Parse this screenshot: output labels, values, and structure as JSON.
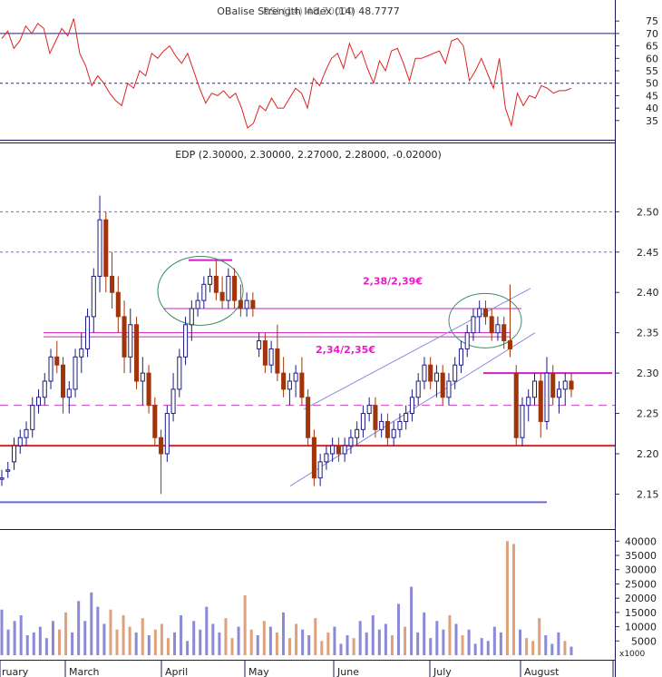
{
  "chart_data": [
    {
      "panel": "indicator",
      "type": "line",
      "title": "OBalise Strength Index (14) 48.7777",
      "title_overlap": "RSI (14) 48,70000",
      "ylim": [
        28,
        82
      ],
      "yticks": [
        35,
        40,
        45,
        50,
        55,
        60,
        65,
        70,
        75
      ],
      "reference_lines": [
        {
          "y": 70,
          "style": "solid",
          "color": "#22227a"
        },
        {
          "y": 50,
          "style": "dashed",
          "color": "#2222aa"
        }
      ],
      "series": [
        {
          "color": "#dd2222",
          "values": [
            68,
            71,
            64,
            67,
            73,
            70,
            74,
            72,
            62,
            67,
            72,
            69,
            76,
            62,
            57,
            49,
            53,
            50,
            46,
            43,
            41,
            50,
            48,
            55,
            53,
            62,
            60,
            63,
            65,
            61,
            58,
            62,
            55,
            48,
            42,
            46,
            45,
            47,
            44,
            46,
            40,
            32,
            34,
            41,
            39,
            44,
            40,
            40,
            44,
            48,
            46,
            40,
            52,
            49,
            55,
            60,
            62,
            56,
            66,
            60,
            63,
            56,
            50,
            59,
            55,
            63,
            64,
            58,
            51,
            60,
            60,
            61,
            62,
            63,
            58,
            67,
            68,
            65,
            51,
            55,
            60,
            54,
            48,
            60,
            40,
            33,
            46,
            41,
            45,
            44,
            49,
            48,
            46,
            47,
            47,
            48
          ]
        }
      ]
    },
    {
      "panel": "price",
      "type": "candlestick",
      "title": "EDP (2.30000, 2.30000, 2.27000, 2.28000, -0.02000)",
      "ylim": [
        2.11,
        2.56
      ],
      "yticks": [
        2.15,
        2.2,
        2.25,
        2.3,
        2.35,
        2.4,
        2.45,
        2.5
      ],
      "ytick_labels": [
        "2.15",
        "2.20",
        "2.25",
        "2.30",
        "2.35",
        "2.40",
        "2.45",
        "2.50"
      ],
      "annotations": [
        {
          "text": "2,38/2,39€",
          "x": "July",
          "y": 2.41,
          "color": "#e020c0"
        },
        {
          "text": "2,34/2,35€",
          "x": "May",
          "y": 2.325,
          "color": "#e020c0"
        }
      ],
      "horizontal_lines": [
        {
          "y": 2.45,
          "style": "dashed",
          "color": "#6a6ad8"
        },
        {
          "y": 2.5,
          "style": "dashed",
          "color": "#6a6ad8"
        },
        {
          "y": 2.26,
          "style": "dashed",
          "color": "#d040c0"
        },
        {
          "y": 2.21,
          "style": "solid",
          "color": "#dd2222"
        },
        {
          "y": 2.14,
          "style": "solid",
          "color": "#6a6ad8"
        }
      ],
      "ohlc": [
        [
          2.17,
          2.18,
          2.16,
          2.17
        ],
        [
          2.18,
          2.19,
          2.17,
          2.18
        ],
        [
          2.19,
          2.22,
          2.18,
          2.21
        ],
        [
          2.21,
          2.23,
          2.2,
          2.22
        ],
        [
          2.22,
          2.24,
          2.21,
          2.23
        ],
        [
          2.23,
          2.27,
          2.22,
          2.26
        ],
        [
          2.26,
          2.28,
          2.25,
          2.27
        ],
        [
          2.27,
          2.3,
          2.26,
          2.29
        ],
        [
          2.29,
          2.33,
          2.28,
          2.32
        ],
        [
          2.32,
          2.34,
          2.3,
          2.31
        ],
        [
          2.31,
          2.32,
          2.25,
          2.27
        ],
        [
          2.27,
          2.29,
          2.25,
          2.28
        ],
        [
          2.28,
          2.33,
          2.27,
          2.32
        ],
        [
          2.32,
          2.35,
          2.3,
          2.33
        ],
        [
          2.33,
          2.38,
          2.32,
          2.37
        ],
        [
          2.37,
          2.43,
          2.35,
          2.42
        ],
        [
          2.42,
          2.52,
          2.4,
          2.49
        ],
        [
          2.49,
          2.5,
          2.4,
          2.42
        ],
        [
          2.42,
          2.45,
          2.38,
          2.4
        ],
        [
          2.4,
          2.42,
          2.35,
          2.37
        ],
        [
          2.37,
          2.39,
          2.3,
          2.32
        ],
        [
          2.32,
          2.38,
          2.3,
          2.36
        ],
        [
          2.36,
          2.37,
          2.28,
          2.29
        ],
        [
          2.29,
          2.32,
          2.26,
          2.3
        ],
        [
          2.3,
          2.31,
          2.25,
          2.26
        ],
        [
          2.26,
          2.27,
          2.21,
          2.22
        ],
        [
          2.22,
          2.23,
          2.15,
          2.2
        ],
        [
          2.2,
          2.26,
          2.19,
          2.25
        ],
        [
          2.25,
          2.3,
          2.24,
          2.28
        ],
        [
          2.28,
          2.33,
          2.27,
          2.32
        ],
        [
          2.32,
          2.37,
          2.31,
          2.36
        ],
        [
          2.36,
          2.39,
          2.34,
          2.38
        ],
        [
          2.38,
          2.4,
          2.37,
          2.39
        ],
        [
          2.39,
          2.42,
          2.38,
          2.41
        ],
        [
          2.41,
          2.43,
          2.4,
          2.42
        ],
        [
          2.42,
          2.44,
          2.39,
          2.4
        ],
        [
          2.4,
          2.42,
          2.38,
          2.39
        ],
        [
          2.39,
          2.43,
          2.38,
          2.42
        ],
        [
          2.42,
          2.43,
          2.38,
          2.39
        ],
        [
          2.39,
          2.41,
          2.37,
          2.38
        ],
        [
          2.38,
          2.4,
          2.37,
          2.39
        ],
        [
          2.39,
          2.4,
          2.37,
          2.38
        ],
        [
          2.33,
          2.35,
          2.32,
          2.34
        ],
        [
          2.34,
          2.35,
          2.3,
          2.31
        ],
        [
          2.31,
          2.34,
          2.3,
          2.33
        ],
        [
          2.33,
          2.36,
          2.29,
          2.3
        ],
        [
          2.3,
          2.32,
          2.27,
          2.28
        ],
        [
          2.28,
          2.3,
          2.26,
          2.29
        ],
        [
          2.29,
          2.31,
          2.27,
          2.3
        ],
        [
          2.3,
          2.32,
          2.26,
          2.27
        ],
        [
          2.27,
          2.28,
          2.21,
          2.22
        ],
        [
          2.22,
          2.23,
          2.16,
          2.17
        ],
        [
          2.17,
          2.2,
          2.16,
          2.19
        ],
        [
          2.19,
          2.21,
          2.18,
          2.2
        ],
        [
          2.2,
          2.22,
          2.19,
          2.21
        ],
        [
          2.21,
          2.22,
          2.19,
          2.2
        ],
        [
          2.2,
          2.22,
          2.19,
          2.21
        ],
        [
          2.21,
          2.23,
          2.2,
          2.22
        ],
        [
          2.22,
          2.24,
          2.21,
          2.23
        ],
        [
          2.23,
          2.26,
          2.22,
          2.25
        ],
        [
          2.25,
          2.27,
          2.24,
          2.26
        ],
        [
          2.26,
          2.27,
          2.22,
          2.23
        ],
        [
          2.23,
          2.25,
          2.22,
          2.24
        ],
        [
          2.24,
          2.25,
          2.21,
          2.22
        ],
        [
          2.22,
          2.24,
          2.21,
          2.23
        ],
        [
          2.23,
          2.25,
          2.22,
          2.24
        ],
        [
          2.24,
          2.26,
          2.23,
          2.25
        ],
        [
          2.25,
          2.28,
          2.24,
          2.27
        ],
        [
          2.27,
          2.3,
          2.26,
          2.29
        ],
        [
          2.29,
          2.32,
          2.28,
          2.31
        ],
        [
          2.31,
          2.32,
          2.28,
          2.29
        ],
        [
          2.29,
          2.31,
          2.27,
          2.3
        ],
        [
          2.3,
          2.31,
          2.26,
          2.27
        ],
        [
          2.27,
          2.3,
          2.26,
          2.29
        ],
        [
          2.29,
          2.32,
          2.28,
          2.31
        ],
        [
          2.31,
          2.34,
          2.3,
          2.33
        ],
        [
          2.33,
          2.36,
          2.32,
          2.35
        ],
        [
          2.35,
          2.38,
          2.34,
          2.37
        ],
        [
          2.37,
          2.39,
          2.35,
          2.38
        ],
        [
          2.38,
          2.39,
          2.36,
          2.37
        ],
        [
          2.37,
          2.38,
          2.34,
          2.35
        ],
        [
          2.35,
          2.37,
          2.34,
          2.36
        ],
        [
          2.36,
          2.37,
          2.33,
          2.34
        ],
        [
          2.34,
          2.41,
          2.32,
          2.33
        ],
        [
          2.3,
          2.31,
          2.21,
          2.22
        ],
        [
          2.22,
          2.27,
          2.21,
          2.26
        ],
        [
          2.26,
          2.28,
          2.24,
          2.27
        ],
        [
          2.27,
          2.3,
          2.26,
          2.29
        ],
        [
          2.29,
          2.3,
          2.22,
          2.24
        ],
        [
          2.24,
          2.32,
          2.23,
          2.3
        ],
        [
          2.3,
          2.31,
          2.26,
          2.27
        ],
        [
          2.27,
          2.29,
          2.25,
          2.28
        ],
        [
          2.28,
          2.3,
          2.26,
          2.29
        ],
        [
          2.29,
          2.3,
          2.27,
          2.28
        ]
      ]
    },
    {
      "panel": "volume",
      "type": "bar",
      "units_label": "x1000",
      "ylim": [
        0,
        42000
      ],
      "yticks": [
        5000,
        10000,
        15000,
        20000,
        25000,
        30000,
        35000,
        40000
      ],
      "ytick_labels": [
        "5000",
        "10000",
        "15000",
        "20000",
        "25000",
        "30000",
        "35000",
        "40000"
      ],
      "values": [
        16000,
        9000,
        12000,
        14000,
        7000,
        8000,
        10000,
        6000,
        12000,
        9000,
        15000,
        8000,
        19000,
        12000,
        22000,
        17000,
        11000,
        16000,
        9000,
        14000,
        10000,
        8000,
        13000,
        7000,
        9000,
        11000,
        6000,
        8000,
        14000,
        5000,
        12000,
        9000,
        17000,
        11000,
        8000,
        13000,
        6000,
        10000,
        21000,
        9000,
        7000,
        12000,
        10000,
        8000,
        15000,
        6000,
        11000,
        9000,
        7000,
        13000,
        5000,
        8000,
        10000,
        4000,
        7000,
        6000,
        12000,
        8000,
        14000,
        9000,
        11000,
        7000,
        18000,
        10000,
        24000,
        8000,
        15000,
        6000,
        12000,
        9000,
        14000,
        11000,
        7000,
        9000,
        4000,
        6000,
        5000,
        10000,
        8000,
        40000,
        39000,
        9000,
        6000,
        5000,
        13000,
        7000,
        4000,
        8000,
        5000,
        3000
      ],
      "x_tick_labels": [
        "ruary",
        "March",
        "April",
        "May",
        "June",
        "July",
        "August"
      ]
    }
  ]
}
